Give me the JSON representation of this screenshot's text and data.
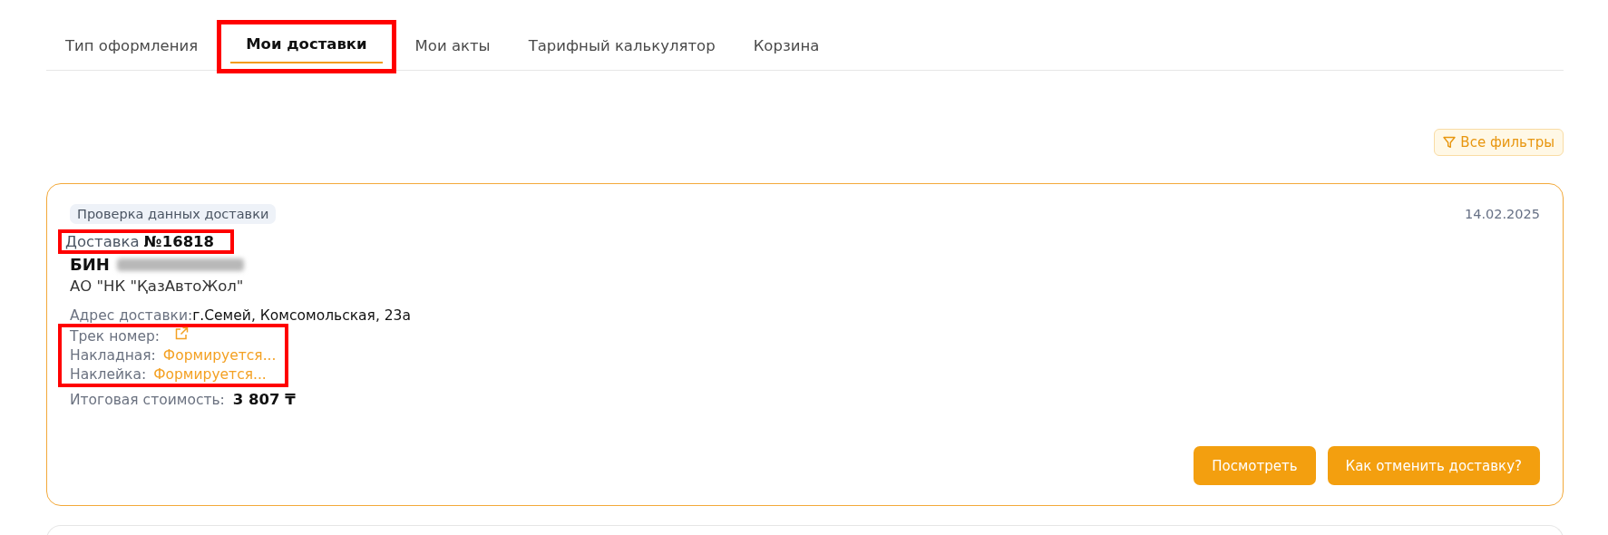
{
  "tabs": [
    {
      "label": "Тип оформления",
      "selected": false,
      "highlighted": false
    },
    {
      "label": "Мои доставки",
      "selected": true,
      "highlighted": true
    },
    {
      "label": "Мои акты",
      "selected": false,
      "highlighted": false
    },
    {
      "label": "Тарифный калькулятор",
      "selected": false,
      "highlighted": false
    },
    {
      "label": "Корзина",
      "selected": false,
      "highlighted": false
    }
  ],
  "filter_button": {
    "label": "Все фильтры"
  },
  "deliveries": [
    {
      "status": "Проверка данных доставки",
      "date": "14.02.2025",
      "title": "Доставка **№16818**",
      "title_highlighted": true,
      "bin": {
        "label": "БИН",
        "redacted": true
      },
      "company": "АО \"НК \"ҚазАвтоЖол\"",
      "address": {
        "label": "Адрес доставки:",
        "value": "г.Семей, Комсомольская, 23а"
      },
      "documents_highlighted": true,
      "documents": [
        {
          "label": "Трек номер:",
          "kind": "link-icon"
        },
        {
          "label": "Накладная:",
          "kind": "text",
          "value": "Формируется..."
        },
        {
          "label": "Наклейка:",
          "kind": "text",
          "value": "Формируется..."
        }
      ],
      "total": {
        "label": "Итоговая стоимость:",
        "value": "3 807 ₸"
      },
      "buttons": [
        "Посмотреть",
        "Как отменить доставку?"
      ]
    }
  ]
}
